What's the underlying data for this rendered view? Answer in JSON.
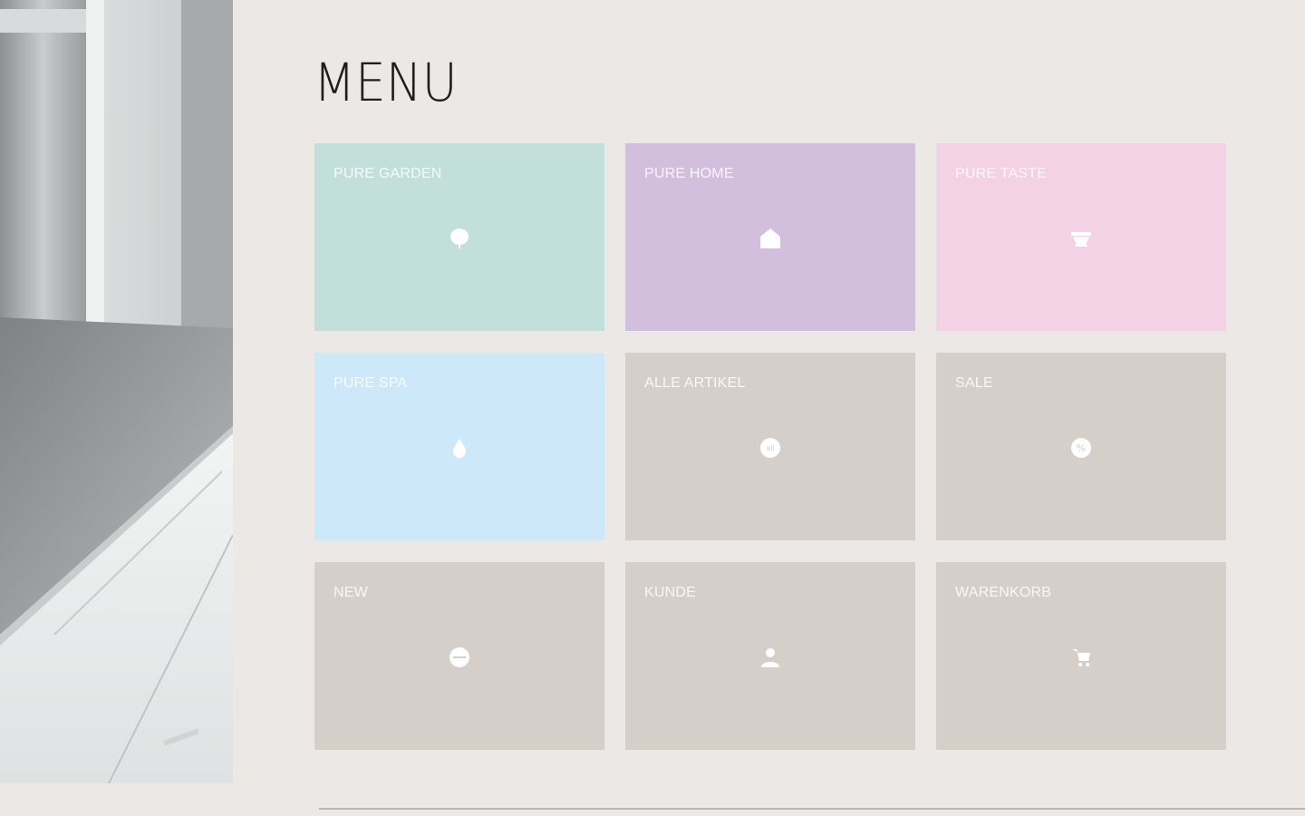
{
  "page": {
    "title": "MENU"
  },
  "tiles": [
    {
      "label": "PURE GARDEN",
      "icon": "leaf-pin-icon",
      "color": "#c2e0d9"
    },
    {
      "label": "PURE HOME",
      "icon": "home-icon",
      "color": "#d2bfdd"
    },
    {
      "label": "PURE TASTE",
      "icon": "bowl-icon",
      "color": "#f4d2e6"
    },
    {
      "label": "PURE SPA",
      "icon": "water-drop-icon",
      "color": "#cde8f9"
    },
    {
      "label": "ALLE ARTIKEL",
      "icon": "all-articles-icon",
      "color": "#d5cfc9"
    },
    {
      "label": "SALE",
      "icon": "percent-icon",
      "color": "#d5cfc9"
    },
    {
      "label": "NEW",
      "icon": "new-badge-icon",
      "color": "#d5cfc9"
    },
    {
      "label": "KUNDE",
      "icon": "user-icon",
      "color": "#d5cfc9"
    },
    {
      "label": "WARENKORB",
      "icon": "cart-icon",
      "color": "#d5cfc9"
    }
  ]
}
